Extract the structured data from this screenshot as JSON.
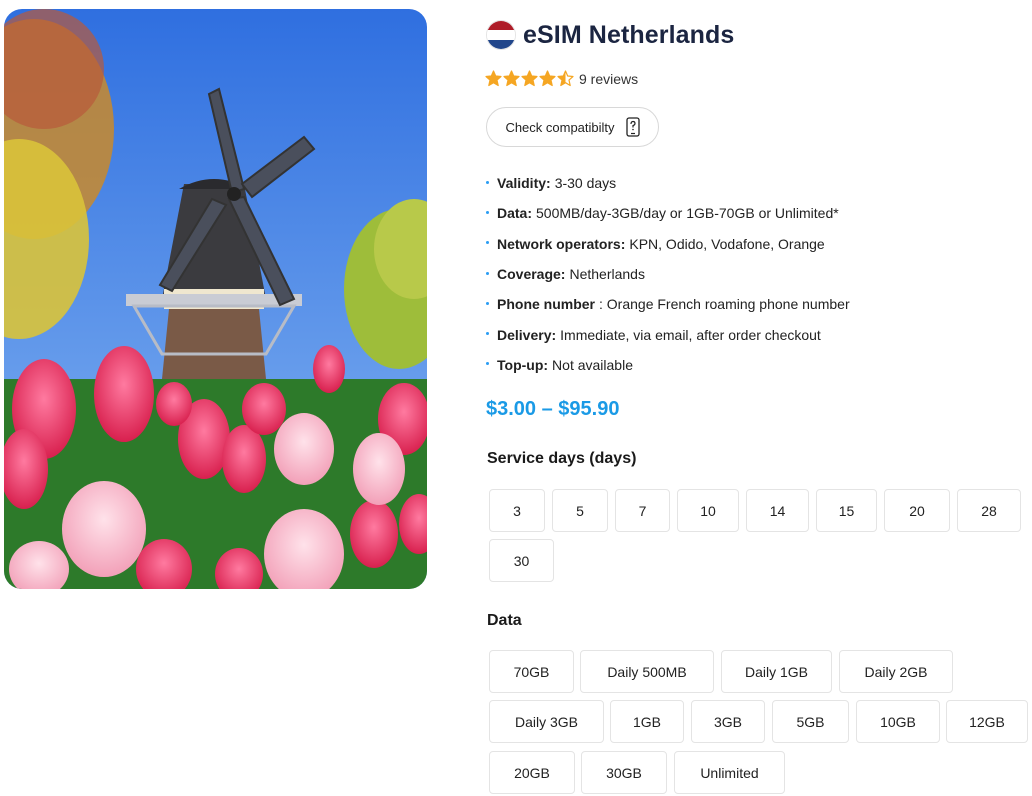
{
  "product": {
    "title": "eSIM Netherlands",
    "flag_colors": [
      "#ae1c28",
      "#ffffff",
      "#21468b"
    ],
    "hero_image": "windmill-tulips",
    "rating": 4.5,
    "rating_max": 5,
    "star_color": "#f5a623",
    "reviews_text": "9 reviews",
    "check_compat_label": "Check compatibilty",
    "check_compat_icon": "phone-question-icon",
    "price_range": "$3.00 – $95.90",
    "price_color": "#1a9ae6"
  },
  "specs": [
    {
      "label": "Validity:",
      "value": "3-30 days"
    },
    {
      "label": "Data:",
      "value": "500MB/day-3GB/day or 1GB-70GB or Unlimited*"
    },
    {
      "label": "Network operators:",
      "value": "KPN, Odido, Vodafone, Orange"
    },
    {
      "label": "Coverage:",
      "value": "Netherlands"
    },
    {
      "label": "Phone number",
      "value": ": Orange French roaming phone number"
    },
    {
      "label": "Delivery:",
      "value": "Immediate, via email, after order checkout"
    },
    {
      "label": "Top-up:",
      "value": "Not available"
    }
  ],
  "service_days": {
    "label": "Service days (days)",
    "options": [
      "3",
      "5",
      "7",
      "10",
      "14",
      "15",
      "20",
      "28",
      "30"
    ]
  },
  "data_plans": {
    "label": "Data",
    "options": [
      "70GB",
      "Daily 500MB",
      "Daily 1GB",
      "Daily 2GB",
      "Daily 3GB",
      "1GB",
      "3GB",
      "5GB",
      "10GB",
      "12GB",
      "20GB",
      "30GB",
      "Unlimited"
    ]
  }
}
